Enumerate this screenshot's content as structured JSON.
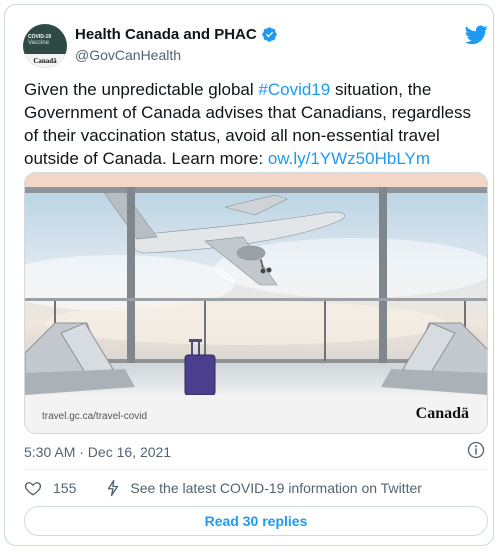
{
  "author": {
    "display_name": "Health Canada and PHAC",
    "handle": "@GovCanHealth",
    "avatar_line1": "COVID-19",
    "avatar_line2": "Vaccine",
    "avatar_brand": "Canadä"
  },
  "tweet": {
    "text_before_hashtag": "Given the unpredictable global ",
    "hashtag": "#Covid19",
    "text_after_hashtag": " situation, the Government of Canada advises that Canadians, regardless of their vaccination status, avoid all non-essential travel outside of Canada. Learn more: ",
    "link": "ow.ly/1YWz50HbLYm"
  },
  "media": {
    "url_text": "travel.gc.ca/travel-covid",
    "brand": "Canadä"
  },
  "timestamp": "5:30 AM · Dec 16, 2021",
  "actions": {
    "like_count": "155",
    "info_message": "See the latest COVID-19 information on Twitter"
  },
  "replies_button": "Read 30 replies",
  "colors": {
    "accent": "#1d9bf0",
    "text": "#0f1419",
    "secondary": "#536471",
    "border": "#cfd9de"
  },
  "icons": [
    "twitter-bird-icon",
    "verified-badge-icon",
    "info-icon",
    "heart-icon",
    "lightning-icon"
  ]
}
